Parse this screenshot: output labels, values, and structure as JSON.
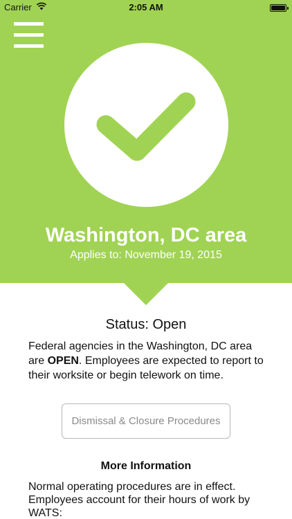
{
  "status_bar": {
    "carrier": "Carrier",
    "time": "2:05 AM",
    "wifi_icon": "wifi-icon",
    "battery_icon": "battery-icon"
  },
  "header": {
    "menu_icon": "hamburger-menu-icon",
    "status_icon": "checkmark-icon",
    "area": "Washington, DC area",
    "applies_to": "Applies to: November 19, 2015"
  },
  "status": {
    "heading": "Status: Open",
    "body_prefix": "Federal agencies in the Washington, DC area are ",
    "body_emphasis": "OPEN",
    "body_suffix": ". Employees are expected to report to their worksite or begin telework on time."
  },
  "procedures_button": {
    "label": "Dismissal & Closure Procedures"
  },
  "more_info": {
    "heading": "More Information",
    "body": "Normal operating procedures are in effect. Employees account for their hours of work by WATS:"
  },
  "colors": {
    "accent": "#a0d353",
    "text": "#111111",
    "button_text": "#8a8a8a",
    "button_border": "#b8b8b8"
  }
}
